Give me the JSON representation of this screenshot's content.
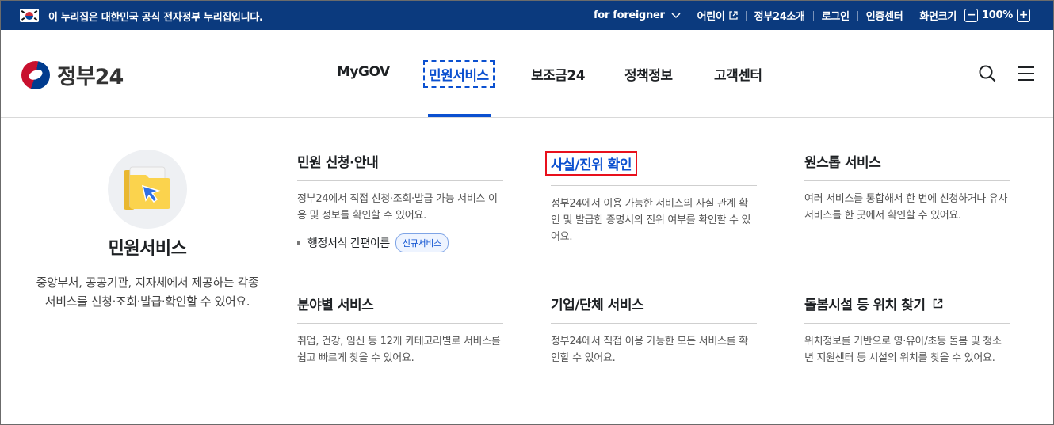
{
  "banner": {
    "text": "이 누리집은 대한민국 공식 전자정부 누리집입니다.",
    "util": {
      "foreigner": "for foreigner",
      "kids": "어린이",
      "about": "정부24소개",
      "login": "로그인",
      "cert": "인증센터",
      "zoom_label": "화면크기",
      "zoom_value": "100%",
      "zoom_minus": "−",
      "zoom_plus": "+"
    }
  },
  "header": {
    "logo_text": "정부24",
    "nav": [
      "MyGOV",
      "민원서비스",
      "보조금24",
      "정책정보",
      "고객센터"
    ],
    "active_nav": "민원서비스"
  },
  "panel": {
    "hero": {
      "title": "민원서비스",
      "description": "중앙부처, 공공기관, 지자체에서 제공하는 각종 서비스를 신청·조회·발급·확인할 수 있어요."
    },
    "cards": [
      {
        "title": "민원 신청·안내",
        "description": "정부24에서 직접 신청·조회·발급 가능 서비스 이용 및 정보를 확인할 수 있어요.",
        "link": "행정서식 간편이름",
        "badge": "신규서비스"
      },
      {
        "title": "사실/진위 확인",
        "description": "정부24에서 이용 가능한 서비스의 사실 관계 확인 및 발급한 증명서의 진위 여부를 확인할 수 있어요."
      },
      {
        "title": "원스톱 서비스",
        "description": "여러 서비스를 통합해서 한 번에 신청하거나 유사 서비스를 한 곳에서 확인할 수 있어요."
      },
      {
        "title": "분야별 서비스",
        "description": "취업, 건강, 임신 등 12개 카테고리별로 서비스를 쉽고 빠르게 찾을 수 있어요."
      },
      {
        "title": "기업/단체 서비스",
        "description": "정부24에서 직접 이용 가능한 모든 서비스를 확인할 수 있어요."
      },
      {
        "title": "돌봄시설 등 위치 찾기",
        "description": "위치정보를 기반으로 영·유아/초등 돌봄 및 청소년 지원센터 등 시설의 위치를 찾을 수 있어요."
      }
    ]
  },
  "colors": {
    "banner_bg": "#0b3a7e",
    "accent": "#0b50d0",
    "highlight_border": "#e8101c"
  }
}
